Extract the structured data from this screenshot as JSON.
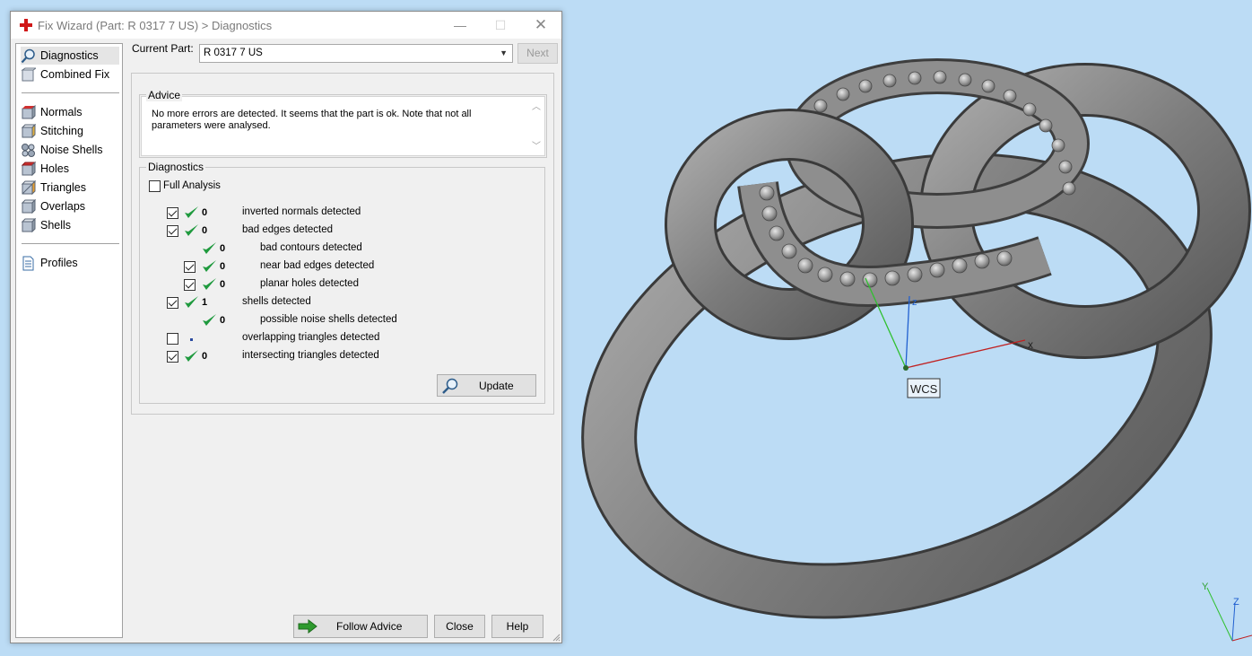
{
  "window": {
    "title": "Fix Wizard (Part: R 0317 7 US) > Diagnostics",
    "minimize_label": "—",
    "maximize_label": "☐",
    "close_label": "✕"
  },
  "sidebar": {
    "items": [
      {
        "label": "Diagnostics",
        "icon": "magnifier-icon"
      },
      {
        "label": "Combined Fix",
        "icon": "combined-fix-icon"
      },
      {
        "label": "Normals",
        "icon": "normals-icon"
      },
      {
        "label": "Stitching",
        "icon": "stitching-icon"
      },
      {
        "label": "Noise Shells",
        "icon": "noise-shells-icon"
      },
      {
        "label": "Holes",
        "icon": "holes-icon"
      },
      {
        "label": "Triangles",
        "icon": "triangles-icon"
      },
      {
        "label": "Overlaps",
        "icon": "overlaps-icon"
      },
      {
        "label": "Shells",
        "icon": "shells-icon"
      },
      {
        "label": "Profiles",
        "icon": "document-icon"
      }
    ]
  },
  "current_part": {
    "label": "Current Part:",
    "value": "R 0317 7 US"
  },
  "next_label": "Next",
  "advice": {
    "title": "Advice",
    "text": "No more errors are detected. It seems that the part is ok. Note that not all parameters were analysed.",
    "scroll_up": "︿",
    "scroll_down": "﹀"
  },
  "diagnostics": {
    "title": "Diagnostics",
    "full_analysis_label": "Full Analysis",
    "full_analysis_checked": false,
    "rows": [
      {
        "checked": true,
        "has_checkbox": true,
        "status": "ok",
        "count": "0",
        "label": "inverted normals detected"
      },
      {
        "checked": true,
        "has_checkbox": true,
        "status": "ok",
        "count": "0",
        "label": "bad edges detected"
      },
      {
        "checked": false,
        "has_checkbox": false,
        "status": "ok",
        "count": "0",
        "label": "bad contours detected"
      },
      {
        "checked": true,
        "has_checkbox": true,
        "status": "ok",
        "count": "0",
        "label": "near bad edges detected"
      },
      {
        "checked": true,
        "has_checkbox": true,
        "status": "ok",
        "count": "0",
        "label": "planar holes detected"
      },
      {
        "checked": true,
        "has_checkbox": true,
        "status": "ok",
        "count": "1",
        "label": "shells detected"
      },
      {
        "checked": false,
        "has_checkbox": false,
        "status": "ok",
        "count": "0",
        "label": "possible noise shells detected"
      },
      {
        "checked": false,
        "has_checkbox": true,
        "status": "not-analysed",
        "count": "",
        "label": "overlapping triangles detected"
      },
      {
        "checked": true,
        "has_checkbox": true,
        "status": "ok",
        "count": "0",
        "label": "intersecting triangles detected"
      }
    ],
    "update_label": "Update"
  },
  "footer": {
    "follow_advice_label": "Follow Advice",
    "close_label": "Close",
    "help_label": "Help"
  },
  "viewport": {
    "axis_x": "x",
    "axis_z": "z",
    "wcs_label": "WCS",
    "corner_axis_y": "Y",
    "corner_axis_z": "Z"
  },
  "colors": {
    "viewport_bg": "#bcdcf5",
    "check_green": "#1f9a3e",
    "axis_x": "#c02020",
    "axis_y": "#30c030",
    "axis_z": "#2060d0"
  }
}
